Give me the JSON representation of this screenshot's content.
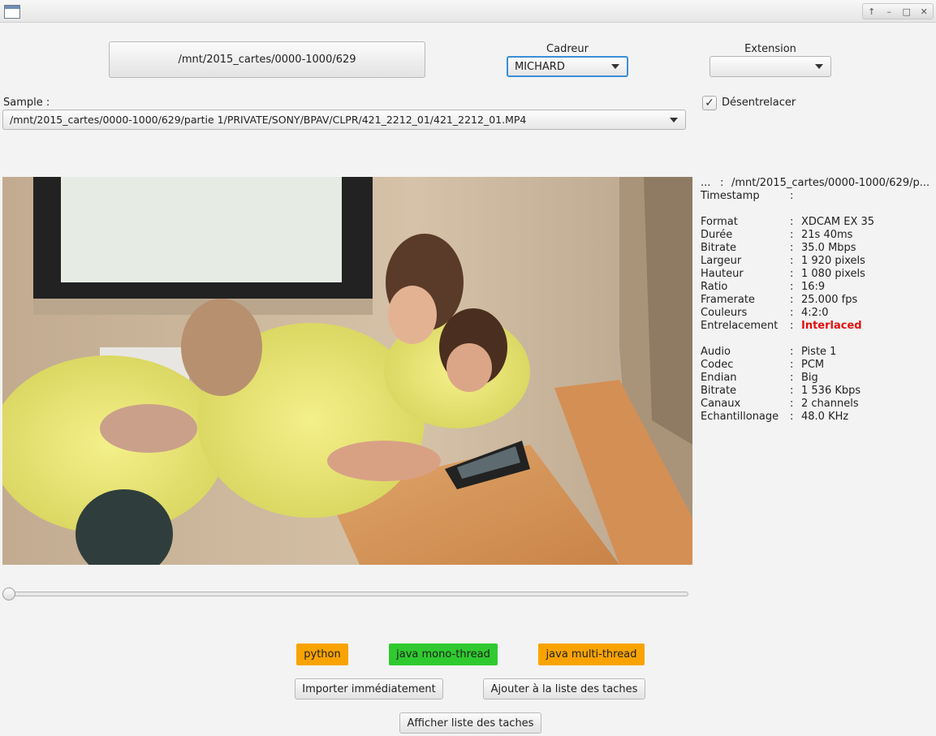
{
  "window": {
    "controls": [
      "↑",
      "–",
      "□",
      "✕"
    ]
  },
  "top": {
    "folder_button": "/mnt/2015_cartes/0000-1000/629",
    "cadreur_label": "Cadreur",
    "cadreur_value": "MICHARD",
    "extension_label": "Extension",
    "extension_value": ""
  },
  "sample": {
    "label": "Sample :",
    "path": "/mnt/2015_cartes/0000-1000/629/partie 1/PRIVATE/SONY/BPAV/CLPR/421_2212_01/421_2212_01.MP4",
    "deinterlace_label": "Désentrelacer",
    "deinterlace_checked": true
  },
  "info": {
    "path_key": "...",
    "path_value": "/mnt/2015_cartes/0000-1000/629/p...",
    "timestamp_key": "Timestamp",
    "timestamp_value": "",
    "video": [
      {
        "k": "Format",
        "v": "XDCAM EX 35"
      },
      {
        "k": "Durée",
        "v": "21s 40ms"
      },
      {
        "k": "Bitrate",
        "v": "35.0 Mbps"
      },
      {
        "k": "Largeur",
        "v": "1 920 pixels"
      },
      {
        "k": "Hauteur",
        "v": "1 080 pixels"
      },
      {
        "k": "Ratio",
        "v": "16:9"
      },
      {
        "k": "Framerate",
        "v": "25.000 fps"
      },
      {
        "k": "Couleurs",
        "v": "4:2:0"
      },
      {
        "k": "Entrelacement",
        "v": "Interlaced"
      }
    ],
    "audio": [
      {
        "k": "Audio",
        "v": "Piste 1"
      },
      {
        "k": "Codec",
        "v": "PCM"
      },
      {
        "k": "Endian",
        "v": "Big"
      },
      {
        "k": "Bitrate",
        "v": "1 536 Kbps"
      },
      {
        "k": "Canaux",
        "v": "2 channels"
      },
      {
        "k": "Echantillonage",
        "v": "48.0 KHz"
      }
    ],
    "separator": ":"
  },
  "slider": {
    "position": 0
  },
  "tags": {
    "python": "python",
    "java_mono": "java mono-thread",
    "java_multi": "java multi-thread"
  },
  "actions": {
    "import_now": "Importer immédiatement",
    "add_to_list": "Ajouter à la liste des taches",
    "show_list": "Afficher liste des taches"
  },
  "colors": {
    "orange": "#f9a300",
    "green": "#2fca2f",
    "interlaced": "#e01010",
    "focus": "#3a8fd6"
  }
}
